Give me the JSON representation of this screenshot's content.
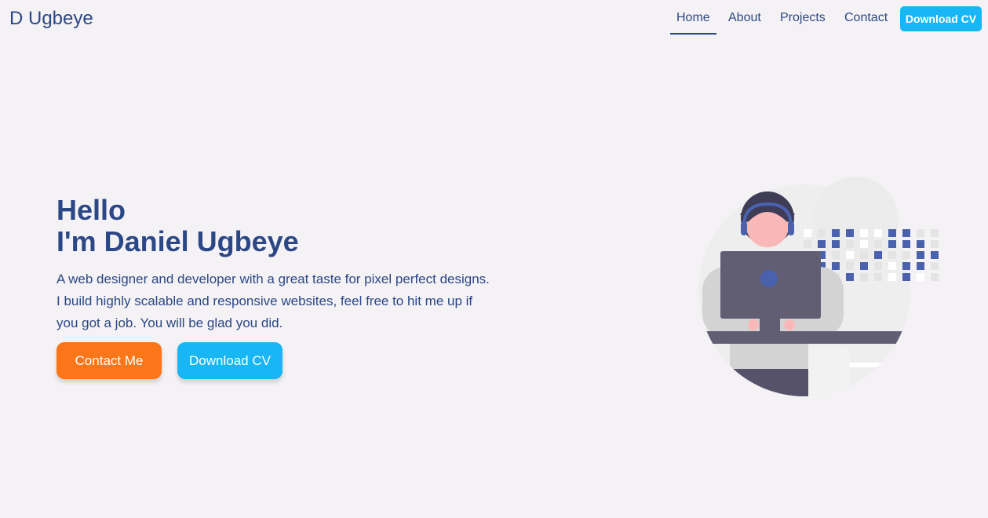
{
  "nav": {
    "brand": "D Ugbeye",
    "items": [
      {
        "label": "Home",
        "active": true
      },
      {
        "label": "About",
        "active": false
      },
      {
        "label": "Projects",
        "active": false
      },
      {
        "label": "Contact",
        "active": false
      }
    ],
    "cv_button": "Download CV"
  },
  "hero": {
    "title_line1": "Hello",
    "title_line2": "I'm Daniel Ugbeye",
    "description": "A web designer and developer with a great taste for pixel perfect designs. I build highly scalable and responsive websites, feel free to hit me up if you got a job. You will be glad you did.",
    "contact_button": "Contact Me",
    "cv_button": "Download CV"
  },
  "colors": {
    "primary": "#2c4786",
    "accent_blue": "#18b6f4",
    "accent_orange": "#fb7519",
    "background": "#f4f2f5"
  }
}
